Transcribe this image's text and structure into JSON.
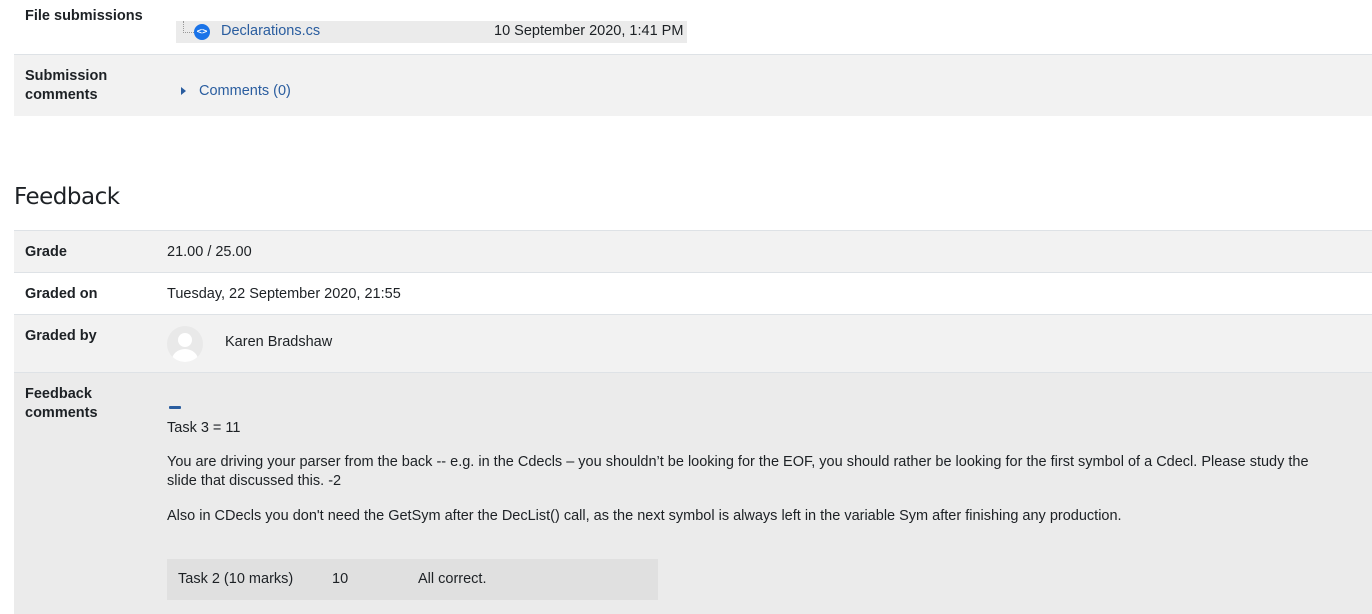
{
  "submission": {
    "file_submissions_label": "File submissions",
    "file_name": "Declarations.cs",
    "file_date": "10 September 2020, 1:41 PM",
    "comments_label_line1": "Submission",
    "comments_label_line2": "comments",
    "comments_link": "Comments (0)"
  },
  "feedback": {
    "heading": "Feedback",
    "grade_label": "Grade",
    "grade_value": "21.00 / 25.00",
    "graded_on_label": "Graded on",
    "graded_on_value": "Tuesday, 22 September 2020, 21:55",
    "graded_by_label": "Graded by",
    "graded_by_value": "Karen Bradshaw",
    "comments_label_line1": "Feedback",
    "comments_label_line2": "comments",
    "task3": "Task 3 = 11",
    "paragraph1_line1": "You are driving your parser from the back  -- e.g. in the Cdecls – you shouldn’t be looking for the EOF, you should rather be looking for the first symbol of a Cdecl. Please study the",
    "paragraph1_line2": "slide that discussed this. -2",
    "paragraph2": "Also in CDecls you don't need the GetSym after the DecList() call, as the next symbol is always left in the variable Sym after finishing any production.",
    "task_table": {
      "task": "Task 2 (10 marks)",
      "marks": "10",
      "comment": "All correct."
    }
  },
  "icons": {
    "file_icon": "code-file-icon",
    "expand_icon": "caret-right-icon",
    "avatar_icon": "user-avatar-icon",
    "collapse_icon": "collapse-dash-icon"
  },
  "colors": {
    "link": "#2a5d9f",
    "row_grey": "#f2f2f2",
    "row_dark": "#ebebeb",
    "file_icon": "#1a73e8"
  }
}
